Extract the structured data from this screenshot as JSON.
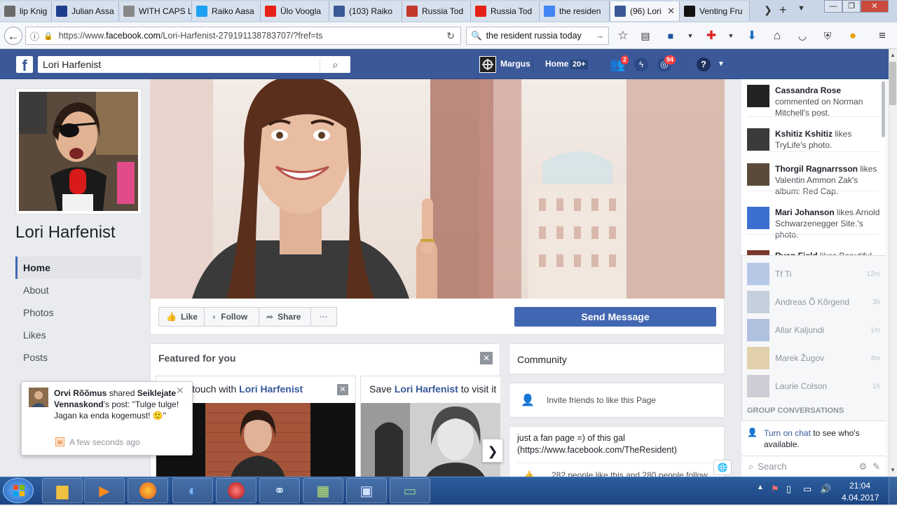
{
  "browser": {
    "tabs": [
      {
        "label": "lip Knig",
        "icon": "book-icon",
        "color": "#6b6b6b",
        "active": false
      },
      {
        "label": "Julian Assa",
        "icon": "news-icon",
        "color": "#1e3f8c",
        "active": false
      },
      {
        "label": "WITH CAPS LO",
        "icon": "page-icon",
        "color": "#888888",
        "active": false
      },
      {
        "label": "Raiko Aasa",
        "icon": "twitter-icon",
        "color": "#1da1f2",
        "active": false
      },
      {
        "label": "Ülo Voogla",
        "icon": "youtube-icon",
        "color": "#e62117",
        "active": false
      },
      {
        "label": "(103) Raiko",
        "icon": "facebook-icon",
        "color": "#3b5998",
        "active": false
      },
      {
        "label": "Russia Tod",
        "icon": "sf-icon",
        "color": "#c0392b",
        "active": false
      },
      {
        "label": "Russia Tod",
        "icon": "youtube-icon",
        "color": "#e62117",
        "active": false
      },
      {
        "label": "the residen",
        "icon": "google-icon",
        "color": "#4285f4",
        "active": false
      },
      {
        "label": "(96) Lori",
        "icon": "facebook-icon",
        "color": "#3b5998",
        "active": true
      },
      {
        "label": "Venting Fru",
        "icon": "t-icon",
        "color": "#111111",
        "active": false
      }
    ],
    "url_host": "https://www.",
    "url_domain": "facebook.com",
    "url_path": "/Lori-Harfenist-279191138783707/?fref=ts",
    "search_value": "the resident russia today"
  },
  "fb": {
    "search_value": "Lori Harfenist",
    "user_name": "Margus",
    "home_label": "Home",
    "home_count": "20+",
    "friend_requests": "2",
    "notifications": "94"
  },
  "page": {
    "name": "Lori Harfenist",
    "nav": [
      "Home",
      "About",
      "Photos",
      "Likes",
      "Posts"
    ],
    "actions": {
      "like": "Like",
      "follow": "Follow",
      "share": "Share",
      "more": "···"
    },
    "send_message": "Send Message",
    "featured_title": "Featured for you",
    "card1_prefix": "Get in touch with ",
    "card1_name": "Lori Harfenist",
    "card2_prefix": "Save ",
    "card2_name": "Lori Harfenist",
    "card2_suffix": " to visit it",
    "community_title": "Community",
    "invite_text": "Invite friends to like this Page",
    "about_text": "just a fan page =) of this gal (https://www.facebook.com/TheResident)",
    "likes_text": "282 people like this and 280 people follow"
  },
  "ticker": [
    {
      "name": "Cassandra Rose",
      "text": " commented on Norman Mitchell's post."
    },
    {
      "name": "Kshitiz Kshitiz",
      "text": " likes TryLife's photo."
    },
    {
      "name": "Thorgil Ragnarrsson",
      "text": " likes Valentin Ammon Zak's album: Red Cap."
    },
    {
      "name": "Mari Johanson",
      "text": " likes Arnold Schwarzenegger Site.'s photo."
    },
    {
      "name": "Ryan Field",
      "text": " likes Beautiful"
    }
  ],
  "chat": [
    {
      "name": "Tf Ti",
      "time": "12m"
    },
    {
      "name": "Andreas Õ Kõrgend",
      "time": "3h"
    },
    {
      "name": "Allar Kaljundi",
      "time": "1m"
    },
    {
      "name": "Marek Žugov",
      "time": "4m"
    },
    {
      "name": "Laurie Colson",
      "time": "1h"
    }
  ],
  "chat_section": "GROUP CONVERSATIONS",
  "chat_turn_on": "Turn on chat",
  "chat_turn_on_suffix": " to see who's available.",
  "chat_search": "Search",
  "notification": {
    "actor": "Orvi Rõõmus",
    "verb": " shared ",
    "target": "Seiklejate Vennaskond",
    "rest": "'s post: \"Tulge tulge! Jagan ka enda kogemust! 🙂\"",
    "time": "A few seconds ago"
  },
  "taskbar": {
    "time": "21:04",
    "date": "4.04.2017"
  }
}
